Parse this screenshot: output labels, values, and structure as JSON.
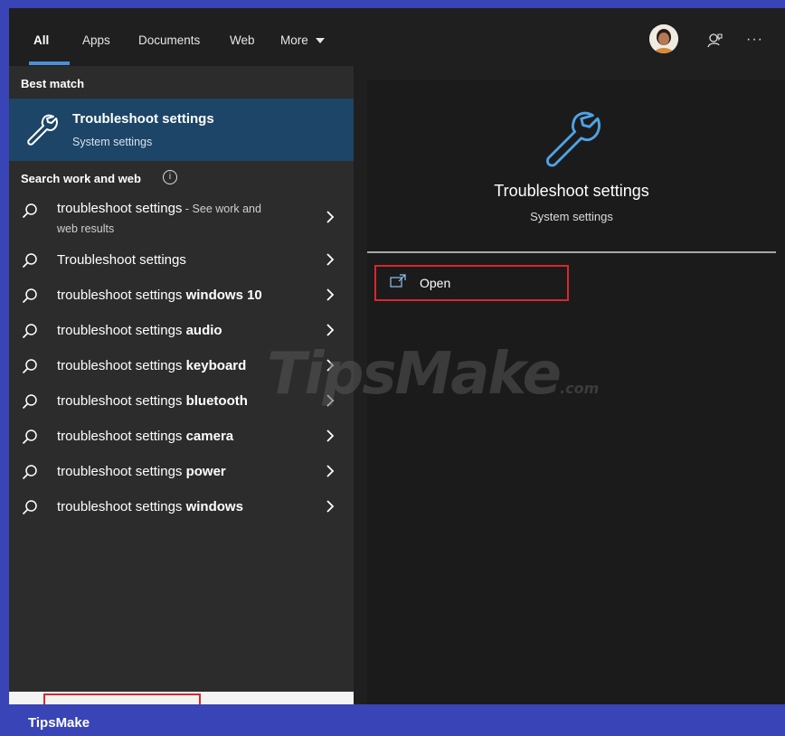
{
  "nav": {
    "tabs": [
      "All",
      "Apps",
      "Documents",
      "Web",
      "More"
    ],
    "active_tab": "All"
  },
  "left": {
    "best_match_label": "Best match",
    "best_match": {
      "title": "Troubleshoot settings",
      "subtitle": "System settings"
    },
    "search_web_label": "Search work and web",
    "results": [
      {
        "prefix": "troubleshoot settings",
        "bold": "",
        "suffix": " - See work and",
        "sub": "web results"
      },
      {
        "prefix": "Troubleshoot settings",
        "bold": ""
      },
      {
        "prefix": "troubleshoot settings ",
        "bold": "windows 10"
      },
      {
        "prefix": "troubleshoot settings ",
        "bold": "audio"
      },
      {
        "prefix": "troubleshoot settings ",
        "bold": "keyboard"
      },
      {
        "prefix": "troubleshoot settings ",
        "bold": "bluetooth"
      },
      {
        "prefix": "troubleshoot settings ",
        "bold": "camera"
      },
      {
        "prefix": "troubleshoot settings ",
        "bold": "power"
      },
      {
        "prefix": "troubleshoot settings ",
        "bold": "windows"
      }
    ]
  },
  "detail": {
    "title": "Troubleshoot settings",
    "subtitle": "System settings",
    "open_label": "Open"
  },
  "watermark": {
    "main": "TipsMake",
    "suffix": ".com"
  },
  "footer": {
    "brand": "TipsMake"
  },
  "colors": {
    "accent": "#4c8fd6",
    "selected_bg": "#1c4567",
    "highlight_box": "#d9262e",
    "page_border": "#3944b6"
  },
  "icons": [
    "wrench-icon",
    "search-icon",
    "chevron-right-icon",
    "info-icon",
    "open-external-icon",
    "feedback-icon",
    "more-options-icon",
    "avatar"
  ]
}
